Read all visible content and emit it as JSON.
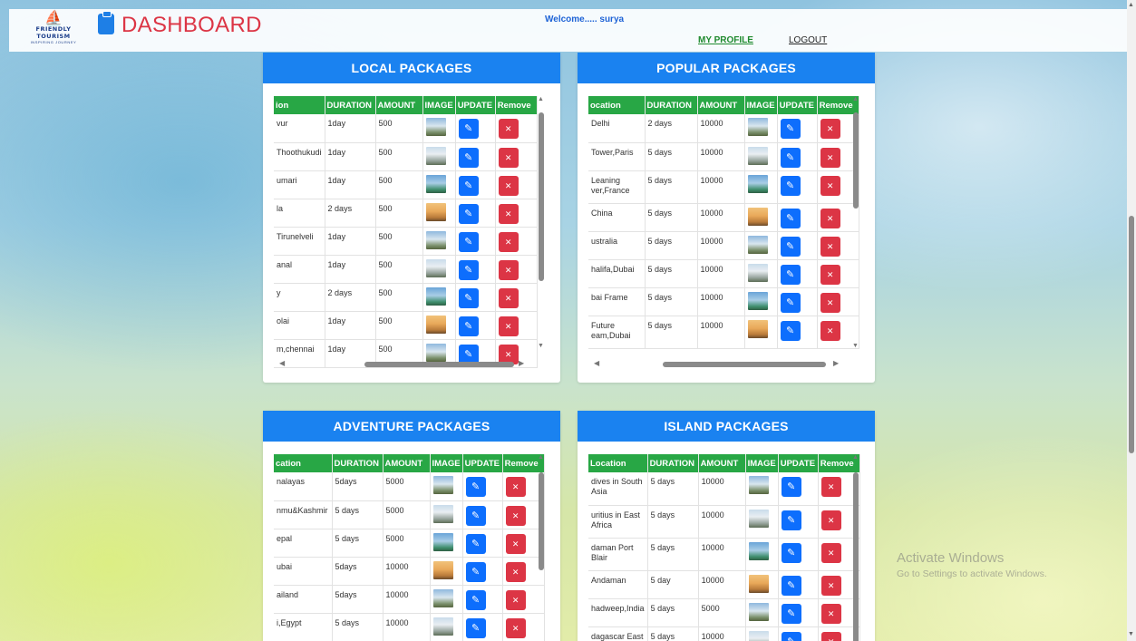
{
  "header": {
    "logo_line1": "FRIENDLY",
    "logo_line2": "TOURISM",
    "logo_tagline": "INSPIRING JOURNEY",
    "title": "DASHBOARD",
    "welcome": "Welcome..... surya",
    "nav_profile": "MY PROFILE",
    "nav_logout": "LOGOUT"
  },
  "icons": {
    "dashboard": "clipboard-icon",
    "edit": "pencil-icon",
    "remove": "x-icon"
  },
  "colors": {
    "header_blue": "#1a82f0",
    "table_head_green": "#28a745",
    "update_blue": "#0d6efd",
    "remove_red": "#dc3545",
    "title_red": "#dc3545"
  },
  "edit_glyph": "✎",
  "remove_glyph": "✕",
  "local": {
    "title": "LOCAL PACKAGES",
    "columns": [
      "ion",
      "DURATION",
      "AMOUNT",
      "IMAGE",
      "UPDATE",
      "Remove"
    ],
    "rows": [
      {
        "location": "vur",
        "duration": "1day",
        "amount": "500"
      },
      {
        "location": "Thoothukudi",
        "duration": "1day",
        "amount": "500"
      },
      {
        "location": "umari",
        "duration": "1day",
        "amount": "500"
      },
      {
        "location": "la",
        "duration": "2 days",
        "amount": "500"
      },
      {
        "location": "Tirunelveli",
        "duration": "1day",
        "amount": "500"
      },
      {
        "location": "anal",
        "duration": "1day",
        "amount": "500"
      },
      {
        "location": "y",
        "duration": "2 days",
        "amount": "500"
      },
      {
        "location": "olai",
        "duration": "1day",
        "amount": "500"
      },
      {
        "location": "m,chennai",
        "duration": "1day",
        "amount": "500"
      }
    ]
  },
  "popular": {
    "title": "POPULAR PACKAGES",
    "columns": [
      "ocation",
      "DURATION",
      "AMOUNT",
      "IMAGE",
      "UPDATE",
      "Remove"
    ],
    "rows": [
      {
        "location": "Delhi",
        "duration": "2 days",
        "amount": "10000"
      },
      {
        "location": "Tower,Paris",
        "duration": "5 days",
        "amount": "10000"
      },
      {
        "location": "Leaning ver,France",
        "duration": "5 days",
        "amount": "10000"
      },
      {
        "location": "China",
        "duration": "5 days",
        "amount": "10000"
      },
      {
        "location": "ustralia",
        "duration": "5 days",
        "amount": "10000"
      },
      {
        "location": "halifa,Dubai",
        "duration": "5 days",
        "amount": "10000"
      },
      {
        "location": "bai Frame",
        "duration": "5 days",
        "amount": "10000"
      },
      {
        "location": "Future eam,Dubai",
        "duration": "5 days",
        "amount": "10000"
      }
    ]
  },
  "adventure": {
    "title": "ADVENTURE PACKAGES",
    "columns": [
      "cation",
      "DURATION",
      "AMOUNT",
      "IMAGE",
      "UPDATE",
      "Remove"
    ],
    "rows": [
      {
        "location": "nalayas",
        "duration": "5days",
        "amount": "5000"
      },
      {
        "location": "nmu&Kashmir",
        "duration": "5 days",
        "amount": "5000"
      },
      {
        "location": "epal",
        "duration": "5 days",
        "amount": "5000"
      },
      {
        "location": "ubai",
        "duration": "5days",
        "amount": "10000"
      },
      {
        "location": "ailand",
        "duration": "5days",
        "amount": "10000"
      },
      {
        "location": "i,Egypt",
        "duration": "5 days",
        "amount": "10000"
      }
    ]
  },
  "island": {
    "title": "ISLAND PACKAGES",
    "columns": [
      "Location",
      "DURATION",
      "AMOUNT",
      "IMAGE",
      "UPDATE",
      "Remove"
    ],
    "rows": [
      {
        "location": "dives in South Asia",
        "duration": "5 days",
        "amount": "10000"
      },
      {
        "location": "uritius in East Africa",
        "duration": "5 days",
        "amount": "10000"
      },
      {
        "location": "daman Port Blair",
        "duration": "5 days",
        "amount": "10000"
      },
      {
        "location": "Andaman",
        "duration": "5 day",
        "amount": "10000"
      },
      {
        "location": "hadweep,India",
        "duration": "5 days",
        "amount": "5000"
      },
      {
        "location": "dagascar East",
        "duration": "5 days",
        "amount": "10000"
      }
    ]
  },
  "watermark": {
    "line1": "Activate Windows",
    "line2": "Go to Settings to activate Windows."
  }
}
